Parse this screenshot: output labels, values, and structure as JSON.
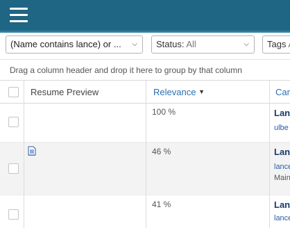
{
  "topbar": {
    "menu_icon": "hamburger-menu-icon",
    "color": "#1f6584"
  },
  "filters": {
    "name_filter": "(Name contains lance)  or ...",
    "status_label": "Status:",
    "status_value": "All",
    "tags_label": "Tags",
    "tags_value": "A"
  },
  "group_panel": {
    "hint": "Drag a column header and drop it here to group by that column"
  },
  "grid": {
    "columns": {
      "resume_preview": "Resume Preview",
      "relevance": "Relevance",
      "relevance_sort": "▼",
      "candidate": "Can"
    },
    "rows": [
      {
        "relevance": "100 %",
        "candidate_name": "Lan",
        "candidate_sub": "ulbe",
        "candidate_sub2": ""
      },
      {
        "relevance": "46 %",
        "candidate_name": "Lan",
        "candidate_sub": "lance",
        "candidate_sub2": "Main"
      },
      {
        "relevance": "41 %",
        "candidate_name": "Lan",
        "candidate_sub": "lance",
        "candidate_sub2": ""
      }
    ]
  },
  "colors": {
    "accent_link": "#2a6fb3",
    "header_blue": "#1f6584"
  }
}
